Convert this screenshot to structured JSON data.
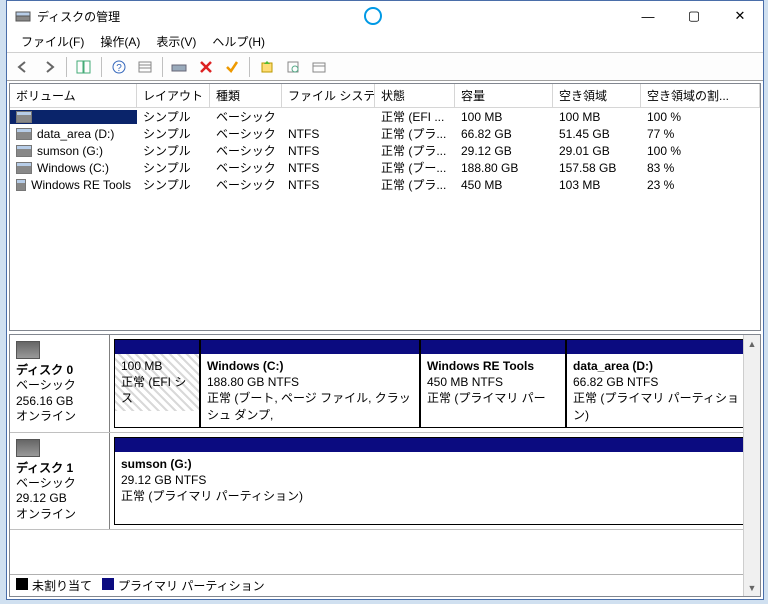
{
  "title": "ディスクの管理",
  "menus": {
    "file": "ファイル(F)",
    "action": "操作(A)",
    "view": "表示(V)",
    "help": "ヘルプ(H)"
  },
  "columns": {
    "volume": "ボリューム",
    "layout": "レイアウト",
    "type": "種類",
    "fs": "ファイル システム",
    "status": "状態",
    "capacity": "容量",
    "free": "空き領域",
    "pctfree": "空き領域の割..."
  },
  "volumes": [
    {
      "name": "",
      "layout": "シンプル",
      "type": "ベーシック",
      "fs": "",
      "status": "正常 (EFI ...",
      "cap": "100 MB",
      "free": "100 MB",
      "pct": "100 %"
    },
    {
      "name": "data_area (D:)",
      "layout": "シンプル",
      "type": "ベーシック",
      "fs": "NTFS",
      "status": "正常 (プラ...",
      "cap": "66.82 GB",
      "free": "51.45 GB",
      "pct": "77 %"
    },
    {
      "name": "sumson (G:)",
      "layout": "シンプル",
      "type": "ベーシック",
      "fs": "NTFS",
      "status": "正常 (プラ...",
      "cap": "29.12 GB",
      "free": "29.01 GB",
      "pct": "100 %"
    },
    {
      "name": "Windows (C:)",
      "layout": "シンプル",
      "type": "ベーシック",
      "fs": "NTFS",
      "status": "正常 (ブー...",
      "cap": "188.80 GB",
      "free": "157.58 GB",
      "pct": "83 %"
    },
    {
      "name": "Windows RE Tools",
      "layout": "シンプル",
      "type": "ベーシック",
      "fs": "NTFS",
      "status": "正常 (プラ...",
      "cap": "450 MB",
      "free": "103 MB",
      "pct": "23 %"
    }
  ],
  "disks": [
    {
      "label": "ディスク 0",
      "type": "ベーシック",
      "size": "256.16 GB",
      "state": "オンライン",
      "partitions": [
        {
          "title": "",
          "sub": "100 MB",
          "detail": "正常 (EFI シス"
        },
        {
          "title": "Windows  (C:)",
          "sub": "188.80 GB NTFS",
          "detail": "正常 (ブート, ページ ファイル, クラッシュ ダンプ,"
        },
        {
          "title": "Windows RE Tools",
          "sub": "450 MB NTFS",
          "detail": "正常 (プライマリ パー"
        },
        {
          "title": "data_area  (D:)",
          "sub": "66.82 GB NTFS",
          "detail": "正常 (プライマリ パーティション)"
        }
      ]
    },
    {
      "label": "ディスク 1",
      "type": "ベーシック",
      "size": "29.12 GB",
      "state": "オンライン",
      "partitions": [
        {
          "title": "sumson  (G:)",
          "sub": "29.12 GB NTFS",
          "detail": "正常 (プライマリ パーティション)"
        }
      ]
    }
  ],
  "legend": {
    "unalloc": "未割り当て",
    "primary": "プライマリ パーティション"
  }
}
